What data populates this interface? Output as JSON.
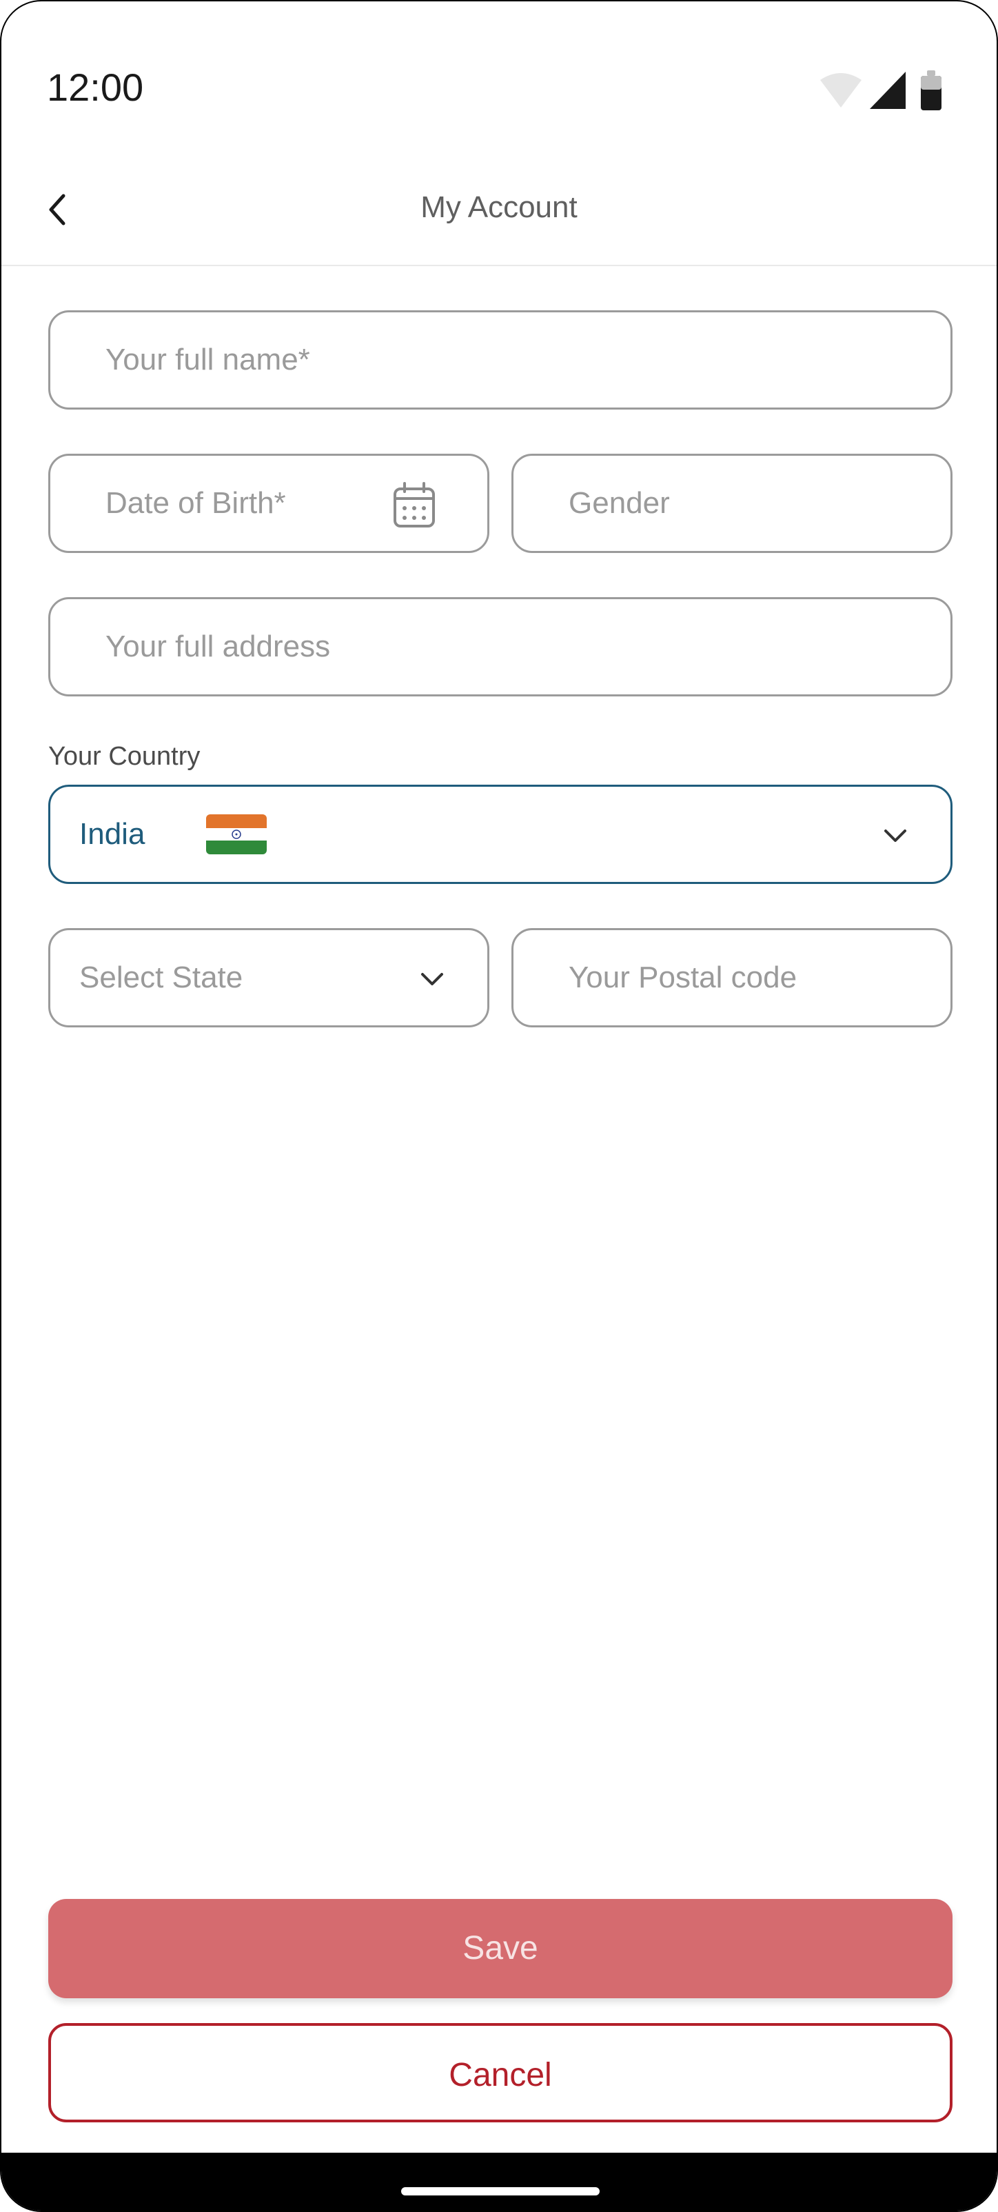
{
  "status_bar": {
    "time": "12:00",
    "icons": [
      "wifi-icon",
      "cellular-signal-icon",
      "battery-icon"
    ]
  },
  "app_bar": {
    "title": "My Account",
    "back_icon": "chevron-left-icon"
  },
  "form": {
    "full_name": {
      "placeholder": "Your full name*",
      "value": ""
    },
    "date_of_birth": {
      "placeholder": "Date of Birth*",
      "value": "",
      "icon": "calendar-icon"
    },
    "gender": {
      "placeholder": "Gender",
      "value": ""
    },
    "address": {
      "placeholder": "Your full address",
      "value": ""
    },
    "country": {
      "label": "Your Country",
      "value": "India",
      "flag": "india-flag-icon"
    },
    "state": {
      "placeholder": "Select State",
      "value": ""
    },
    "postal_code": {
      "placeholder": "Your Postal code",
      "value": ""
    }
  },
  "actions": {
    "save_label": "Save",
    "cancel_label": "Cancel"
  },
  "colors": {
    "accent": "#1f5c7c",
    "save_button": "#d56b6f",
    "cancel_border": "#b3202a",
    "field_border": "#9b9b9b",
    "placeholder": "#9a9a9a"
  }
}
